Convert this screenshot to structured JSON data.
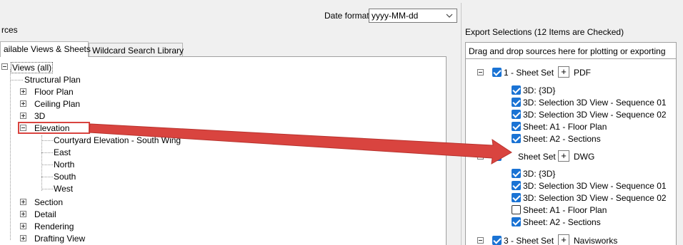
{
  "date_format": {
    "label": "Date format:",
    "value": "yyyy-MM-dd"
  },
  "sources": {
    "title": "rces",
    "tabs": [
      {
        "label": "ailable Views & Sheets",
        "active": true
      },
      {
        "label": "Wildcard Search Library",
        "active": false
      }
    ],
    "tree": {
      "root": "Views (all)",
      "items": {
        "structural_plan": "Structural Plan",
        "floor_plan": "Floor Plan",
        "ceiling_plan": "Ceiling Plan",
        "three_d": "3D",
        "elevation": "Elevation",
        "courtyard": "Courtyard Elevation - South Wing",
        "east": "East",
        "north": "North",
        "south": "South",
        "west": "West",
        "section": "Section",
        "detail": "Detail",
        "rendering": "Rendering",
        "drafting_view": "Drafting View"
      }
    }
  },
  "export": {
    "title": "Export Selections (12 Items are Checked)",
    "header": "Drag and drop sources here for plotting or exporting",
    "sets": [
      {
        "name": "1 - Sheet Set",
        "format": "PDF",
        "items": [
          {
            "label": "3D: {3D}",
            "checked": true
          },
          {
            "label": "3D: Selection 3D View - Sequence 01",
            "checked": true
          },
          {
            "label": "3D: Selection 3D View - Sequence 02",
            "checked": true
          },
          {
            "label": "Sheet: A1 - Floor Plan",
            "checked": true
          },
          {
            "label": "Sheet: A2 - Sections",
            "checked": true
          }
        ]
      },
      {
        "name": "Sheet Set",
        "format": "DWG",
        "items": [
          {
            "label": "3D: {3D}",
            "checked": true
          },
          {
            "label": "3D: Selection 3D View - Sequence 01",
            "checked": true
          },
          {
            "label": "3D: Selection 3D View - Sequence 02",
            "checked": true
          },
          {
            "label": "Sheet: A1 - Floor Plan",
            "checked": false
          },
          {
            "label": "Sheet: A2 - Sections",
            "checked": true
          }
        ]
      },
      {
        "name": "3 - Sheet Set",
        "format": "Navisworks",
        "items": []
      }
    ]
  },
  "plus_symbol": "+",
  "annotation": {
    "color": "#d9443f"
  }
}
